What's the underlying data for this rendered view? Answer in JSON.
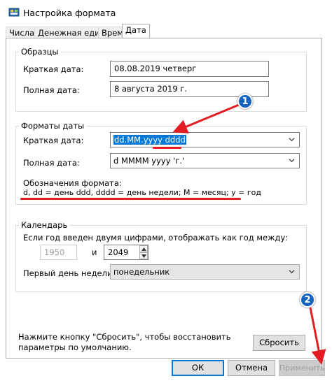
{
  "window": {
    "title": "Настройка формата"
  },
  "tabs": [
    {
      "label": "Числа"
    },
    {
      "label": "Денежная единица"
    },
    {
      "label": "Время"
    },
    {
      "label": "Дата"
    }
  ],
  "samples": {
    "legend": "Образцы",
    "short_label": "Краткая дата:",
    "short_value": "08.08.2019 четверг",
    "long_label": "Полная дата:",
    "long_value": "8 августа 2019 г."
  },
  "formats": {
    "legend": "Форматы даты",
    "short_label": "Краткая дата:",
    "short_value": "dd.MM.yyyy dddd",
    "long_label": "Полная дата:",
    "long_value": "d MMMM yyyy 'г.'",
    "notation_title": "Обозначения формата:",
    "notation_text": "d, dd = день  ddd, dddd = день недели; M = месяц; y = год"
  },
  "calendar": {
    "legend": "Календарь",
    "two_digit_label": "Если год введен двумя цифрами, отображать как год между:",
    "year_from": "1950",
    "and_label": "и",
    "year_to": "2049",
    "first_day_label": "Первый день недели:",
    "first_day_value": "понедельник"
  },
  "reset": {
    "text_line1": "Нажмите кнопку \"Сбросить\", чтобы восстановить",
    "text_line2": "параметры по умолчанию.",
    "button_label": "Сбросить"
  },
  "footer": {
    "ok_label": "ОК",
    "cancel_label": "Отмена",
    "apply_label": "Применить"
  },
  "annotations": {
    "badge1": "1",
    "badge2": "2"
  },
  "colors": {
    "accent": "#0078d7",
    "annotation_red": "#e41c23",
    "badge_blue": "#1565c0"
  }
}
